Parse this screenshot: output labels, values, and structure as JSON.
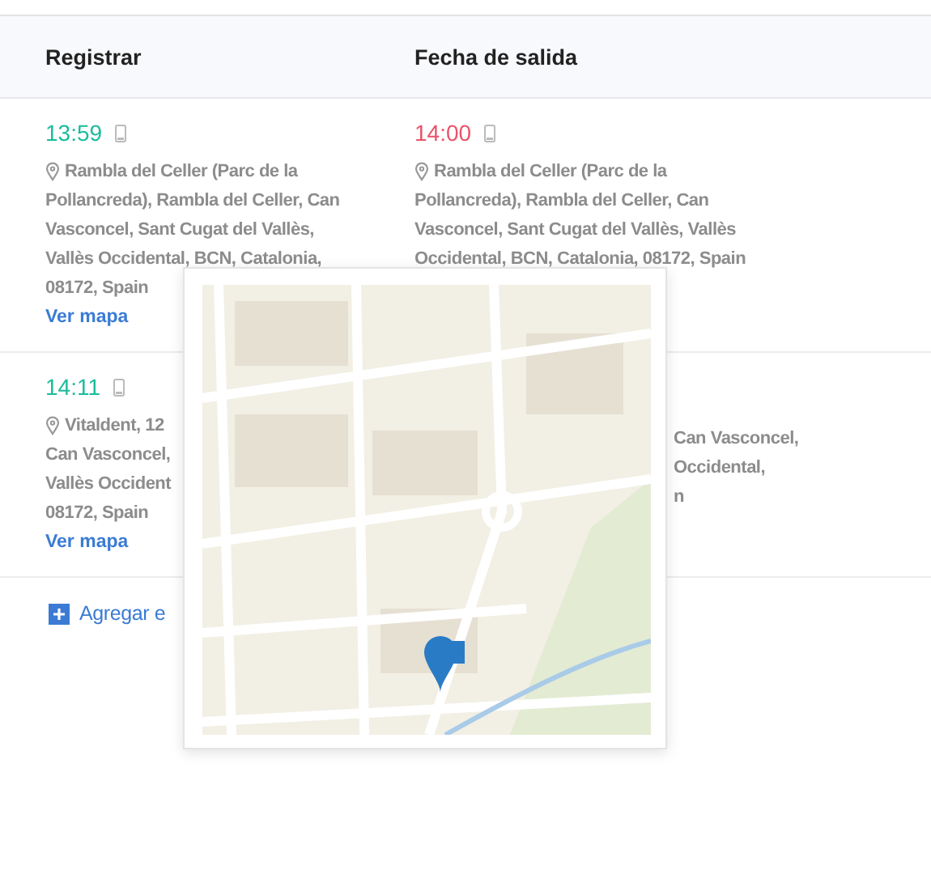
{
  "table": {
    "columns": [
      "Registrar",
      "Fecha de salida"
    ],
    "rows": [
      {
        "cells": [
          {
            "time": "13:59",
            "color": "#1abc9c",
            "address_lines": [
              "Rambla del Celler (Parc de la",
              "Pollancreda), Rambla del Celler, Can",
              "Vasconcel, Sant Cugat del Vallès,",
              "Vallès Occidental, BCN, Catalonia,",
              "08172, Spain"
            ],
            "link": "Ver mapa"
          },
          {
            "time": "14:00",
            "color": "#e9546b",
            "address_lines": [
              "Rambla del Celler (Parc de la",
              "Pollancreda), Rambla del Celler, Can",
              "Vasconcel, Sant Cugat del Vallès, Vallès",
              "Occidental, BCN, Catalonia, 08172, Spain"
            ]
          }
        ]
      },
      {
        "cells": [
          {
            "time": "14:11",
            "color": "#1abc9c",
            "address_lines": [
              "Vitaldent, 12",
              "Can Vasconcel,",
              "Vallès Occident",
              "08172, Spain"
            ],
            "link": "Ver mapa"
          },
          {
            "address_lines": [
              "Can Vasconcel,",
              "Occidental,",
              "n"
            ],
            "kind": "partial"
          }
        ]
      }
    ]
  },
  "add_button": {
    "label": "Agregar e"
  }
}
